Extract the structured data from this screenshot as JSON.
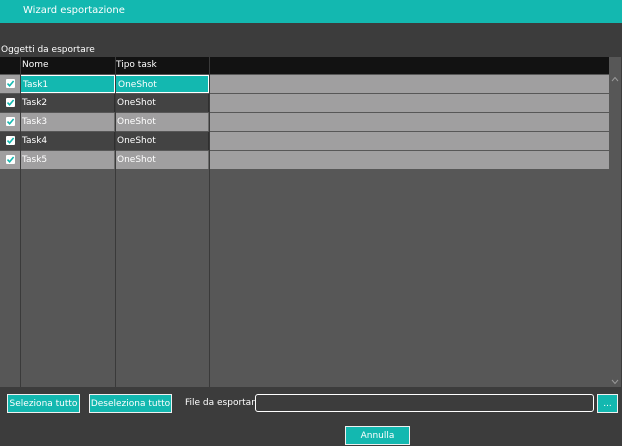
{
  "window": {
    "title": "Wizard esportazione"
  },
  "objects_label": "Oggetti da esportare",
  "columns": {
    "name": "Nome",
    "type": "Tipo task"
  },
  "rows": [
    {
      "name": "Task1",
      "type": "OneShot",
      "checked": true
    },
    {
      "name": "Task2",
      "type": "OneShot",
      "checked": true
    },
    {
      "name": "Task3",
      "type": "OneShot",
      "checked": true
    },
    {
      "name": "Task4",
      "type": "OneShot",
      "checked": true
    },
    {
      "name": "Task5",
      "type": "OneShot",
      "checked": true
    }
  ],
  "footer": {
    "select_all": "Seleziona tutto",
    "deselect_all": "Deseleziona tutto",
    "file_label": "File da esportare",
    "file_value": "",
    "browse": "...",
    "cancel": "Annulla"
  },
  "colors": {
    "accent": "#13b8b0",
    "background": "#3c3c3c"
  }
}
